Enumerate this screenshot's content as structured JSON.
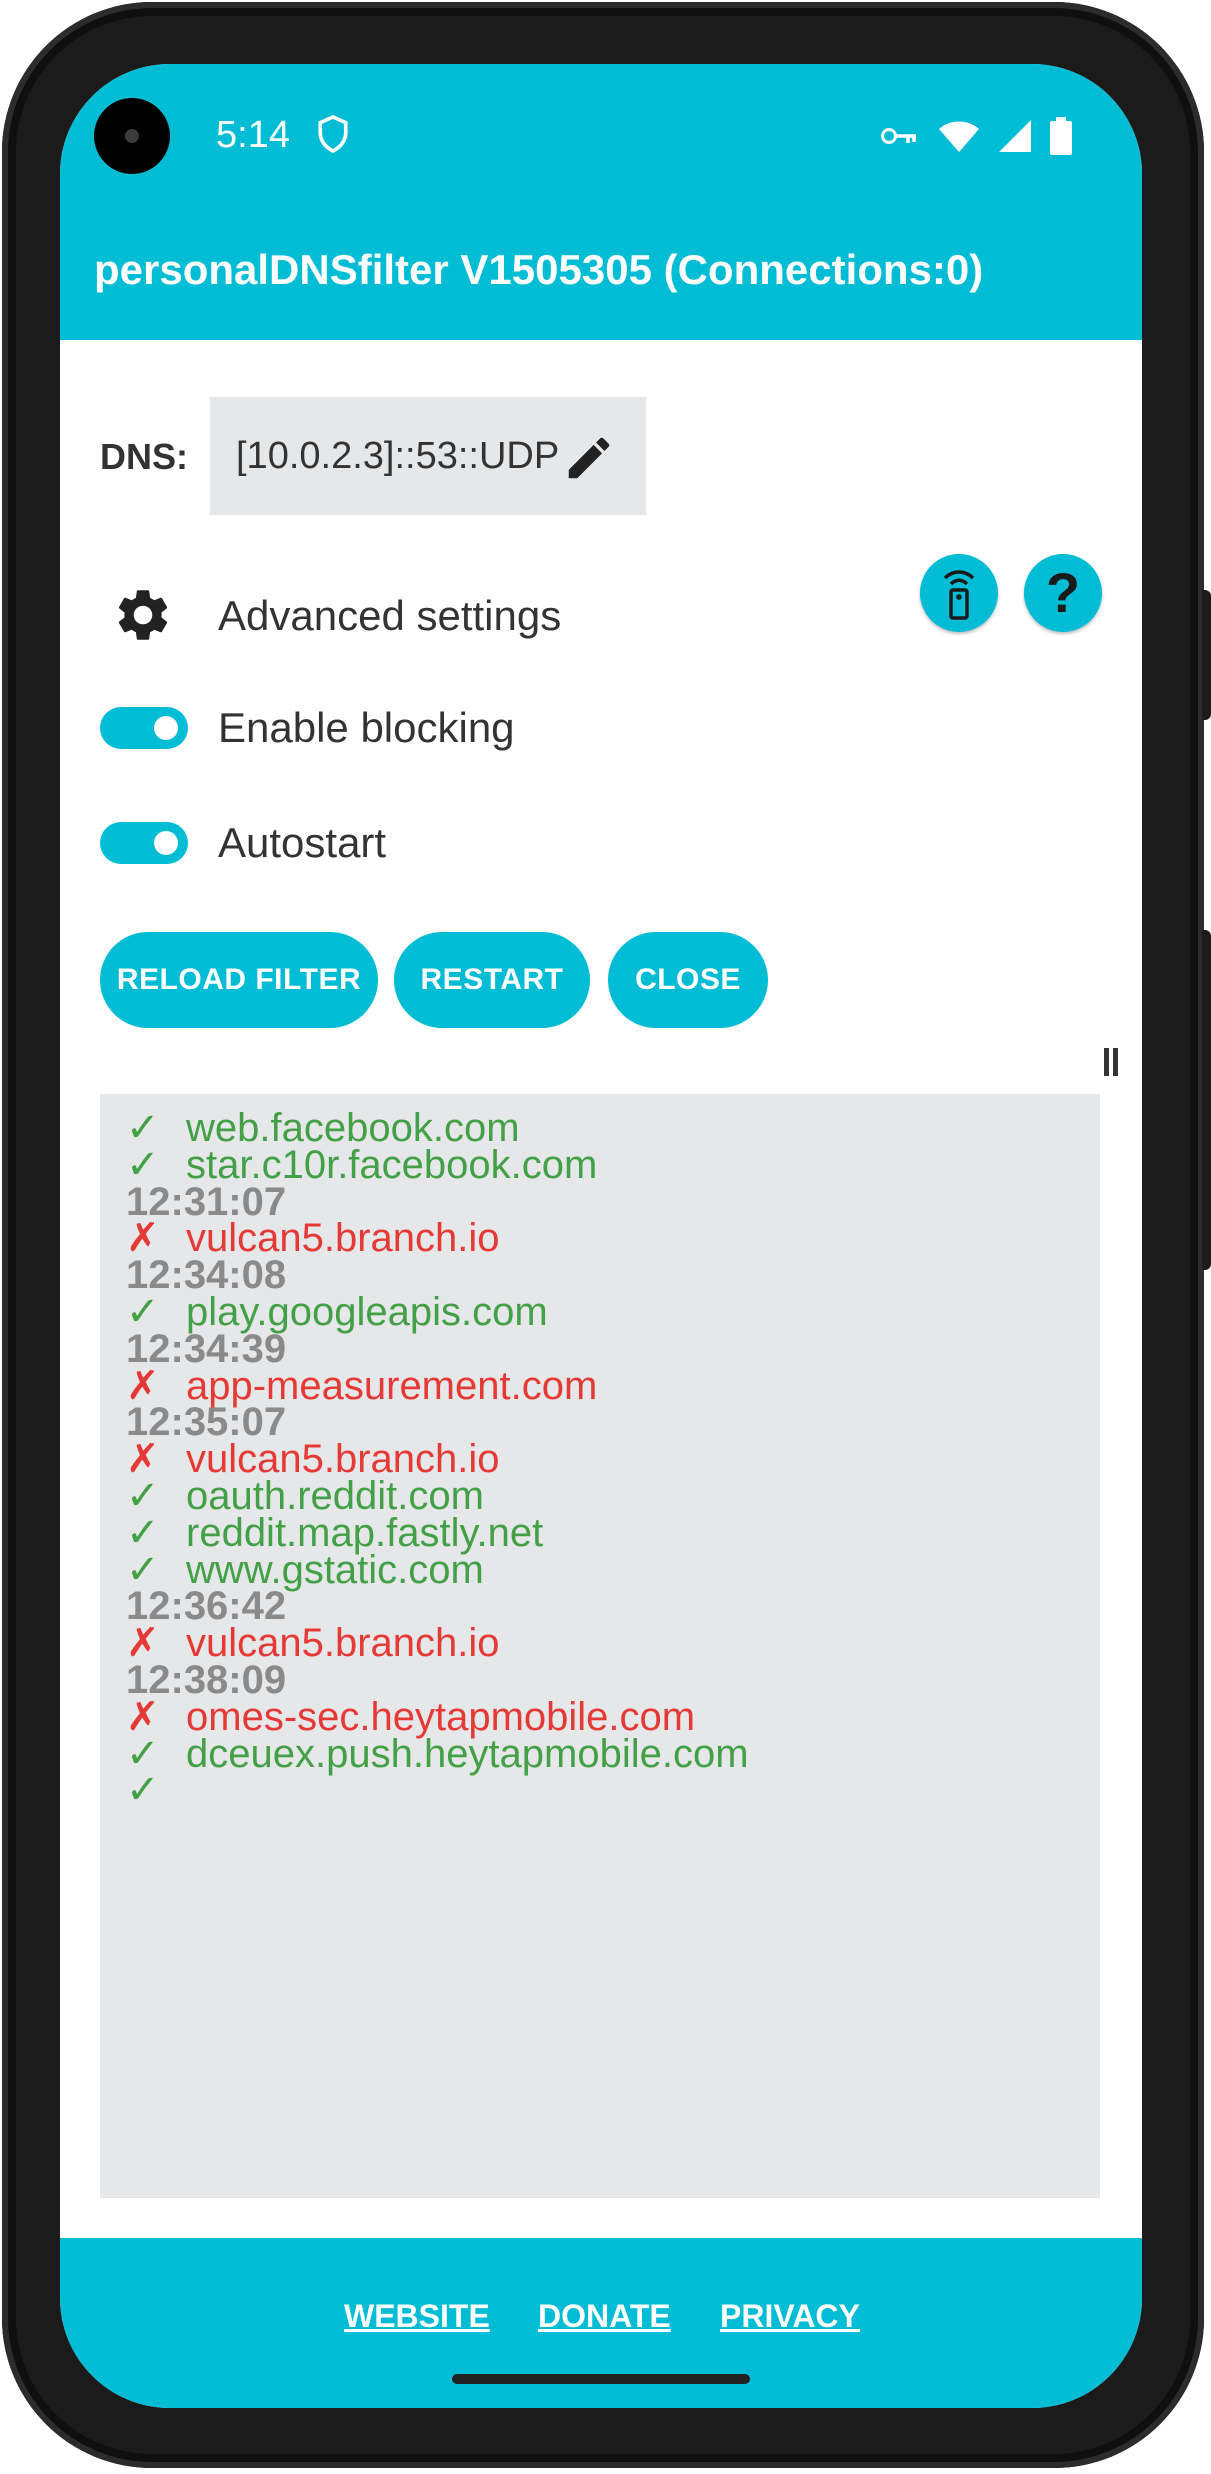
{
  "status_bar": {
    "time": "5:14",
    "icons": [
      "shield-icon",
      "vpn-key-icon",
      "wifi-icon",
      "cell-signal-icon",
      "battery-icon"
    ]
  },
  "app_bar": {
    "title": "personalDNSfilter V1505305 (Connections:0)"
  },
  "dns": {
    "label": "DNS:",
    "value": "[10.0.2.3]::53::UDP"
  },
  "settings": {
    "advanced_label": "Advanced settings"
  },
  "toggles": [
    {
      "label": "Enable blocking",
      "on": true
    },
    {
      "label": "Autostart",
      "on": true
    }
  ],
  "actions": {
    "reload": "RELOAD FILTER",
    "restart": "RESTART",
    "close": "CLOSE"
  },
  "log": [
    {
      "type": "ok",
      "mark": "✓",
      "text": "web.facebook.com"
    },
    {
      "type": "ok",
      "mark": "✓",
      "text": "star.c10r.facebook.com"
    },
    {
      "type": "time",
      "mark": "",
      "text": "12:31:07"
    },
    {
      "type": "blocked",
      "mark": "✗",
      "text": "vulcan5.branch.io"
    },
    {
      "type": "time",
      "mark": "",
      "text": "12:34:08"
    },
    {
      "type": "ok",
      "mark": "✓",
      "text": "play.googleapis.com"
    },
    {
      "type": "time",
      "mark": "",
      "text": "12:34:39"
    },
    {
      "type": "blocked",
      "mark": "✗",
      "text": "app-measurement.com"
    },
    {
      "type": "time",
      "mark": "",
      "text": "12:35:07"
    },
    {
      "type": "blocked",
      "mark": "✗",
      "text": "vulcan5.branch.io"
    },
    {
      "type": "ok",
      "mark": "✓",
      "text": "oauth.reddit.com"
    },
    {
      "type": "ok",
      "mark": "✓",
      "text": "reddit.map.fastly.net"
    },
    {
      "type": "ok",
      "mark": "✓",
      "text": "www.gstatic.com"
    },
    {
      "type": "time",
      "mark": "",
      "text": "12:36:42"
    },
    {
      "type": "blocked",
      "mark": "✗",
      "text": "vulcan5.branch.io"
    },
    {
      "type": "time",
      "mark": "",
      "text": "12:38:09"
    },
    {
      "type": "blocked",
      "mark": "✗",
      "text": "omes-sec.heytapmobile.com"
    },
    {
      "type": "ok",
      "mark": "✓",
      "text": "dceuex.push.heytapmobile.com"
    },
    {
      "type": "ok",
      "mark": "✓",
      "text": ""
    }
  ],
  "footer": {
    "website": "WEBSITE",
    "donate": "DONATE",
    "privacy": "PRIVACY"
  },
  "colors": {
    "accent": "#00BCD4",
    "allowed": "#43a047",
    "blocked": "#e53935",
    "timestamp": "#8a8a8a",
    "log_background": "#e6e7e9"
  }
}
